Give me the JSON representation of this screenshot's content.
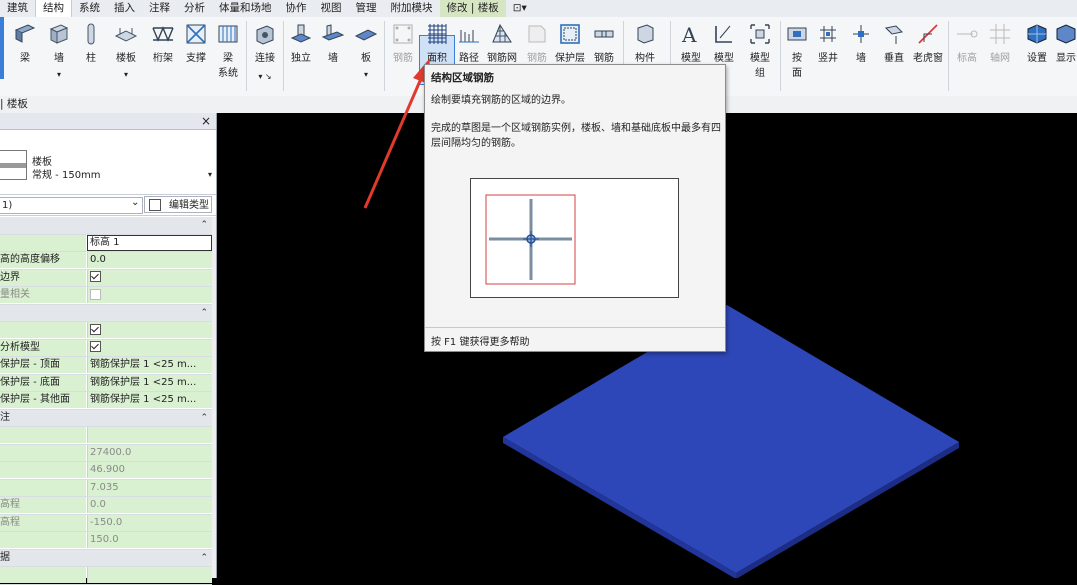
{
  "tabs": [
    "建筑",
    "结构",
    "系统",
    "插入",
    "注释",
    "分析",
    "体量和场地",
    "协作",
    "视图",
    "管理",
    "附加模块",
    "修改 | 楼板",
    "⊡▾"
  ],
  "ribbon": {
    "beam": "梁",
    "wall": "墙",
    "column": "柱",
    "floor": "楼板",
    "truss": "桁架",
    "brace": "支撑",
    "beam_system": "梁\n系统",
    "connection": "连接",
    "isolated": "独立",
    "wall_f": "墙",
    "slab_f": "板",
    "rebar": "钢筋",
    "area": "面积",
    "path": "路径",
    "fabric": "钢筋网",
    "fabric_area": "钢筋",
    "cover": "保护层",
    "rebar2": "钢筋",
    "component": "构件",
    "model_text": "模型",
    "model_line": "模型",
    "model_group": "模型\n组",
    "by_face": "按\n面",
    "shaft": "竖井",
    "wall_o": "墙",
    "vertical": "垂直",
    "dormer": "老虎窗",
    "level": "标高",
    "grid": "轴网",
    "settings": "设置",
    "show": "显示"
  },
  "optbar": {
    "label": "| 楼板"
  },
  "properties": {
    "close": "×",
    "type_family": "楼板",
    "type_name": "常规 - 150mm",
    "filter": "1)",
    "edit_type": "编辑类型",
    "rows": [
      {
        "kind": "cat",
        "label": ""
      },
      {
        "label": "",
        "value": "标高 1",
        "boxed": true
      },
      {
        "label": "高的高度偏移",
        "value": "0.0"
      },
      {
        "label": "边界",
        "check": true
      },
      {
        "label": "量相关",
        "check": false,
        "grey": true
      },
      {
        "kind": "cat",
        "label": ""
      },
      {
        "label": "",
        "check": true
      },
      {
        "label": "分析模型",
        "check": true
      },
      {
        "label": "保护层 - 顶面",
        "value": "钢筋保护层 1 <25 m..."
      },
      {
        "label": "保护层 - 底面",
        "value": "钢筋保护层 1 <25 m..."
      },
      {
        "label": "保护层 - 其他面",
        "value": "钢筋保护层 1 <25 m..."
      },
      {
        "kind": "cat",
        "label": "注"
      },
      {
        "label": "",
        "value": "",
        "grey": true
      },
      {
        "label": "",
        "value": "27400.0",
        "grey": true
      },
      {
        "label": "",
        "value": "46.900",
        "grey": true
      },
      {
        "label": "",
        "value": "7.035",
        "grey": true
      },
      {
        "label": "高程",
        "value": "0.0",
        "grey": true
      },
      {
        "label": "高程",
        "value": "-150.0",
        "grey": true
      },
      {
        "label": "",
        "value": "150.0",
        "grey": true
      },
      {
        "kind": "cat",
        "label": "据"
      },
      {
        "label": "",
        "value": ""
      }
    ]
  },
  "tooltip": {
    "title": "结构区域钢筋",
    "desc1": "绘制要填充钢筋的区域的边界。",
    "desc2": "完成的草图是一个区域钢筋实例，楼板、墙和基础底板中最多有四层间隔均匀的钢筋。",
    "footer": "按 F1 键获得更多帮助"
  },
  "colors": {
    "slab": "#2e47b8",
    "arrow": "#e03a2f",
    "selection": "#3b7ed8",
    "green_cell": "#d9f0d1"
  }
}
